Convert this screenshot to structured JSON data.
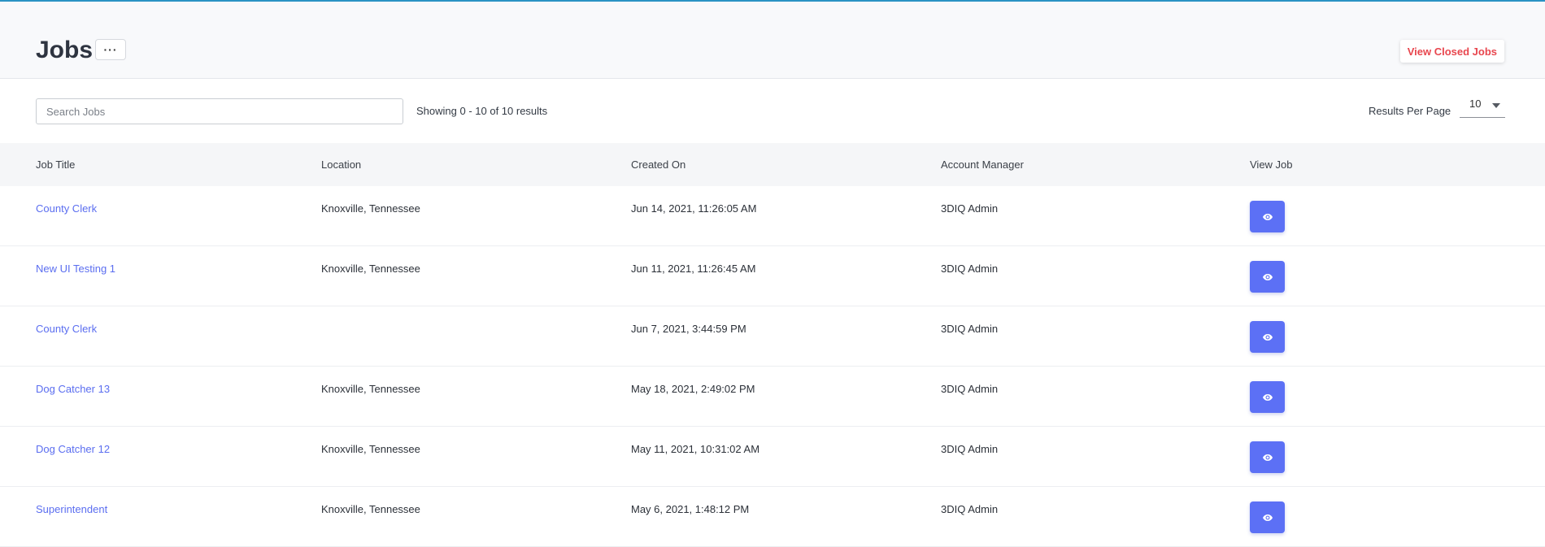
{
  "header": {
    "title": "Jobs",
    "more_label": "···",
    "closed_jobs_label": "View Closed Jobs"
  },
  "toolbar": {
    "search_placeholder": "Search Jobs",
    "search_value": "",
    "showing_text": "Showing 0 - 10 of 10 results",
    "results_per_page_label": "Results Per Page",
    "results_per_page_value": "10"
  },
  "table": {
    "columns": [
      "Job Title",
      "Location",
      "Created On",
      "Account Manager",
      "View Job"
    ],
    "rows": [
      {
        "title": "County Clerk",
        "location": "Knoxville, Tennessee",
        "created": "Jun 14, 2021, 11:26:05 AM",
        "manager": "3DIQ Admin"
      },
      {
        "title": "New UI Testing 1",
        "location": "Knoxville, Tennessee",
        "created": "Jun 11, 2021, 11:26:45 AM",
        "manager": "3DIQ Admin"
      },
      {
        "title": "County Clerk",
        "location": "",
        "created": "Jun 7, 2021, 3:44:59 PM",
        "manager": "3DIQ Admin"
      },
      {
        "title": "Dog Catcher 13",
        "location": "Knoxville, Tennessee",
        "created": "May 18, 2021, 2:49:02 PM",
        "manager": "3DIQ Admin"
      },
      {
        "title": "Dog Catcher 12",
        "location": "Knoxville, Tennessee",
        "created": "May 11, 2021, 10:31:02 AM",
        "manager": "3DIQ Admin"
      },
      {
        "title": "Superintendent",
        "location": "Knoxville, Tennessee",
        "created": "May 6, 2021, 1:48:12 PM",
        "manager": "3DIQ Admin"
      }
    ]
  },
  "icons": {
    "view_button_icon": "eye-icon",
    "rpp_caret_icon": "caret-down-icon"
  },
  "colors": {
    "accent": "#5c70f5",
    "link": "#5b6ef0",
    "danger": "#e8464e",
    "top_border": "#2a93c4"
  }
}
